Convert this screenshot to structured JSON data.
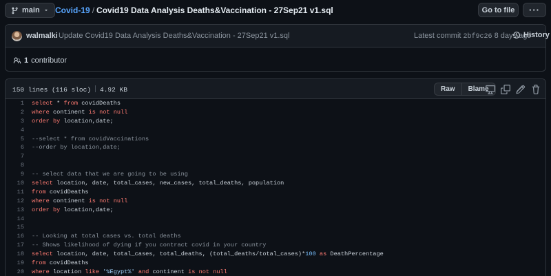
{
  "topbar": {
    "branch": "main",
    "repo": "Covid-19",
    "separator": "/",
    "filename": "Covid19 Data Analysis Deaths&Vaccination - 27Sep21 v1.sql",
    "goto_label": "Go to file",
    "more_label": "···"
  },
  "commit": {
    "author": "walmalki",
    "message": "Update Covid19 Data Analysis Deaths&Vaccination - 27Sep21 v1.sql",
    "latest_label": "Latest commit",
    "sha": "2bf9c26",
    "age": "8 days ago",
    "history_label": "History",
    "contributors_count": "1",
    "contributors_label": "contributor"
  },
  "file": {
    "lines_info": "150 lines (116 sloc)",
    "size": "4.92 KB",
    "raw_label": "Raw",
    "blame_label": "Blame"
  },
  "code_lines": [
    {
      "n": "1",
      "text": "select * from covidDeaths"
    },
    {
      "n": "2",
      "text": "where continent is not null"
    },
    {
      "n": "3",
      "text": "order by location,date;"
    },
    {
      "n": "4",
      "text": ""
    },
    {
      "n": "5",
      "text": "--select * from covidVaccinations"
    },
    {
      "n": "6",
      "text": "--order by location,date;"
    },
    {
      "n": "7",
      "text": ""
    },
    {
      "n": "8",
      "text": ""
    },
    {
      "n": "9",
      "text": "-- select data that we are going to be using"
    },
    {
      "n": "10",
      "text": "select location, date, total_cases, new_cases, total_deaths, population"
    },
    {
      "n": "11",
      "text": "from covidDeaths"
    },
    {
      "n": "12",
      "text": "where continent is not null"
    },
    {
      "n": "13",
      "text": "order by location,date;"
    },
    {
      "n": "14",
      "text": ""
    },
    {
      "n": "15",
      "text": ""
    },
    {
      "n": "16",
      "text": "-- Looking at total cases vs. total deaths"
    },
    {
      "n": "17",
      "text": "-- Shows likelihood of dying if you contract covid in your country"
    },
    {
      "n": "18",
      "text": "select location, date, total_cases, total_deaths, (total_deaths/total_cases)*100 as DeathPercentage"
    },
    {
      "n": "19",
      "text": "from covidDeaths"
    },
    {
      "n": "20",
      "text": "where location like '%Egypt%' and continent is not null"
    }
  ],
  "icons": [
    "git-branch-icon",
    "chevron-down-icon",
    "history-icon",
    "people-icon",
    "desktop-icon",
    "copy-icon",
    "pencil-icon",
    "trash-icon"
  ],
  "colors": {
    "background": "#0d1117",
    "link": "#58a6ff",
    "keyword": "#ff7b72",
    "comment": "#8b949e",
    "string": "#a5d6ff",
    "number": "#79c0ff"
  }
}
